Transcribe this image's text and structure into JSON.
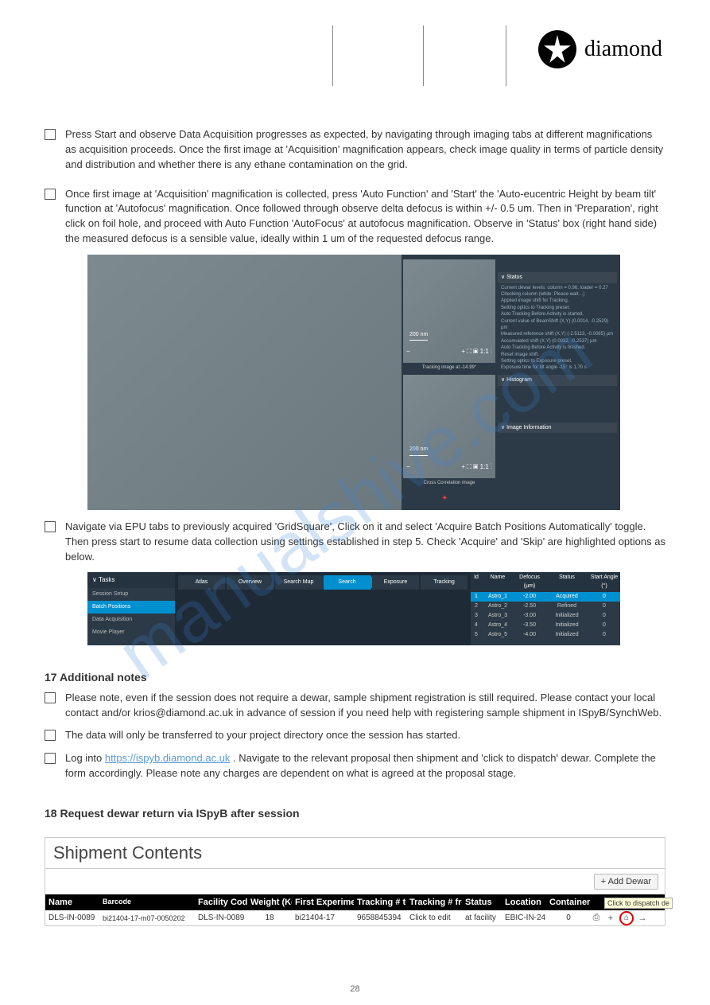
{
  "brand": {
    "name": "diamond"
  },
  "watermark": "manualshive.com",
  "page_number": "28",
  "bullets": {
    "b1": "Press Start and observe Data Acquisition progresses as expected, by navigating through imaging tabs at different magnifications as acquisition proceeds. Once the first image at 'Acquisition' magnification appears, check image quality in terms of particle density and distribution and whether there is any ethane contamination on the grid.",
    "b2": "Once first image at 'Acquisition' magnification is collected, press 'Auto Function' and 'Start' the 'Auto-eucentric Height by beam tilt' function at 'Autofocus' magnification. Once followed through observe delta defocus is within +/- 0.5 um. Then in 'Preparation', right click on foil hole, and proceed with Auto Function 'AutoFocus' at autofocus magnification. Observe in 'Status' box (right hand side) the measured defocus is a sensible value, ideally within 1 um of the requested defocus range.",
    "b3": "Navigate via EPU tabs to previously acquired 'GridSquare', Click on it and select 'Acquire Batch Positions Automatically' toggle. Then press start to resume data collection using settings established in step 5. Check 'Acquire' and 'Skip' are highlighted options as below."
  },
  "screenshot1": {
    "scale1": "200 nm",
    "scale2": "200 nm",
    "caption1": "Tracking image at -14.99°",
    "caption2": "Cross Correlation image",
    "status_head": "Status",
    "status": [
      "Current dewar levels: column = 0.96, loader = 0.27",
      "Checking column (while: Please wait…)",
      "Applied image shift for Tracking.",
      "Setting optics to Tracking preset.",
      "Auto Tracking Before Activity is started.",
      "Current value of BeamShift (X,Y) (0.0014, -0.2529) µm",
      "Measured reference shift (X,Y) (-2.5113, -0.0065) µm",
      "Accumulated shift (X,Y) (0.0032, -0.2537) µm",
      "Auto Tracking Before Activity is finished.",
      "Reset image shift.",
      "Setting optics to Exposure preset.",
      "Exposure time for tilt angle -15° is 1.70 s"
    ],
    "histogram_head": "Histogram",
    "imageinfo_head": "Image Information"
  },
  "screenshot2": {
    "tasks_head": "Tasks",
    "tasks": [
      "Session Setup",
      "Batch Positions",
      "Data Acquisition",
      "Movie Player"
    ],
    "tabs": [
      "Atlas",
      "Overview",
      "Search Map",
      "Search",
      "Exposure",
      "Tracking"
    ],
    "table": {
      "headers": [
        "Id",
        "Name",
        "Defocus (µm)",
        "Status",
        "Start Angle (°)"
      ],
      "rows": [
        {
          "id": "1",
          "name": "Astro_1",
          "def": "-2.00",
          "status": "Acquired",
          "angle": "0"
        },
        {
          "id": "2",
          "name": "Astro_2",
          "def": "-2.50",
          "status": "Refined",
          "angle": "0"
        },
        {
          "id": "3",
          "name": "Astro_3",
          "def": "-3.00",
          "status": "Initialized",
          "angle": "0"
        },
        {
          "id": "4",
          "name": "Astro_4",
          "def": "-3.50",
          "status": "Initialized",
          "angle": "0"
        },
        {
          "id": "5",
          "name": "Astro_5",
          "def": "-4.00",
          "status": "Initialized",
          "angle": "0"
        }
      ]
    }
  },
  "bullets2": {
    "b4a": "Please note, even if the session does not require a dewar, sample shipment registration is still required. Please contact your local contact and/or",
    "b4b": "in advance of session if you need help with registering sample shipment in ISpyB/SynchWeb.",
    "b5": "The data will only be transferred to your project directory once the session has started.",
    "b6a": "Log into",
    "b6b": ". Navigate to the relevant proposal then shipment and 'click to dispatch' dewar. Complete the form accordingly. Please note any charges are dependent on what is agreed at the proposal stage."
  },
  "support_email": "krios@diamond.ac.uk",
  "ispyb_link": "https://ispyb.diamond.ac.uk",
  "section1": "17 Additional notes",
  "section2": "18 Request dewar return via ISpyB after session",
  "shipment": {
    "title": "Shipment Contents",
    "add_btn": "+ Add Dewar",
    "tooltip": "Click to dispatch de",
    "headers": [
      "Name",
      "Barcode",
      "Facility Code",
      "Weight (Kg)",
      "First Experiment",
      "Tracking # to",
      "Tracking # from",
      "Status",
      "Location",
      "Containers"
    ],
    "row": {
      "name": "DLS-IN-0089",
      "barcode": "bi21404-17-m07-0050202",
      "facility": "DLS-IN-0089",
      "weight": "18",
      "experiment": "bi21404-17",
      "tracking_to": "9658845394",
      "tracking_from": "Click to edit",
      "status": "at facility",
      "location": "EBIC-IN-24",
      "containers": "0"
    }
  }
}
